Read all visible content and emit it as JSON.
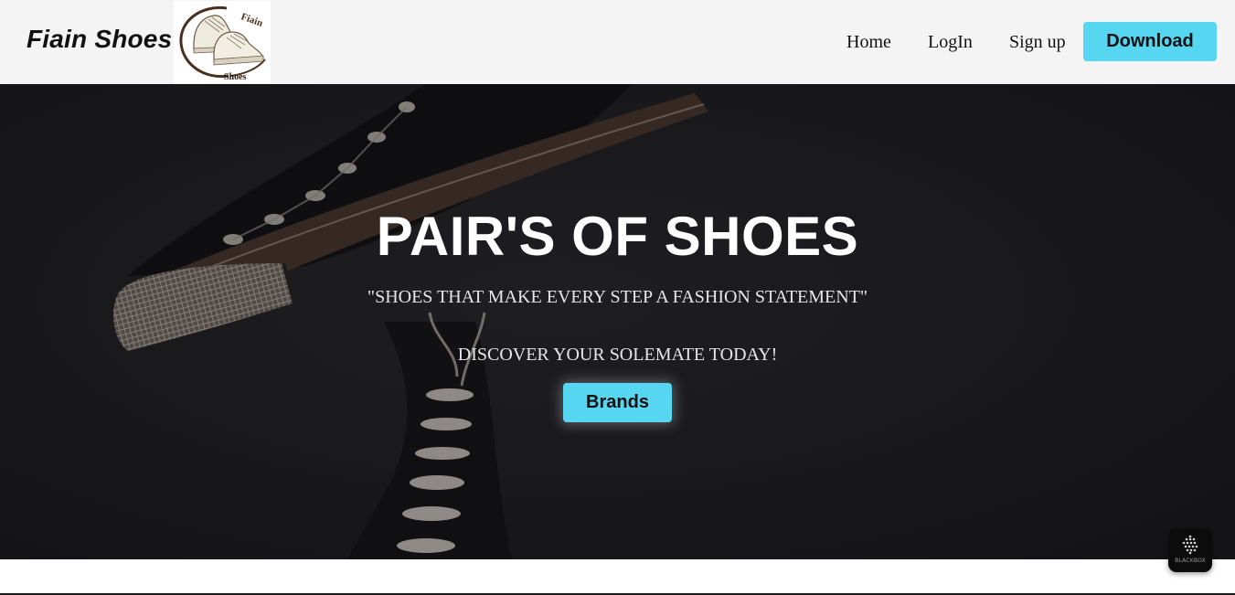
{
  "header": {
    "brand_name": "Fiain Shoes",
    "logo": {
      "text_top": "Fiain",
      "text_bottom": "Shoes",
      "icon": "sneakers-logo-icon"
    },
    "nav": {
      "home": "Home",
      "login": "LogIn",
      "signup": "Sign up"
    },
    "download_label": "Download"
  },
  "hero": {
    "title": "PAIR'S OF SHOES",
    "tagline": "\"SHOES THAT MAKE EVERY STEP A FASHION STATEMENT\"",
    "subtitle": "DISCOVER YOUR SOLEMATE TODAY!",
    "brands_label": "Brands",
    "background_icon": "sneaker-photo"
  },
  "widget": {
    "label": "BLACKBOX",
    "icon": "blackbox-icon"
  },
  "colors": {
    "accent": "#56d6f0",
    "header_bg": "#f4f4f4",
    "hero_bg": "#202024",
    "text_dark": "#111111",
    "text_light": "#ffffff"
  }
}
